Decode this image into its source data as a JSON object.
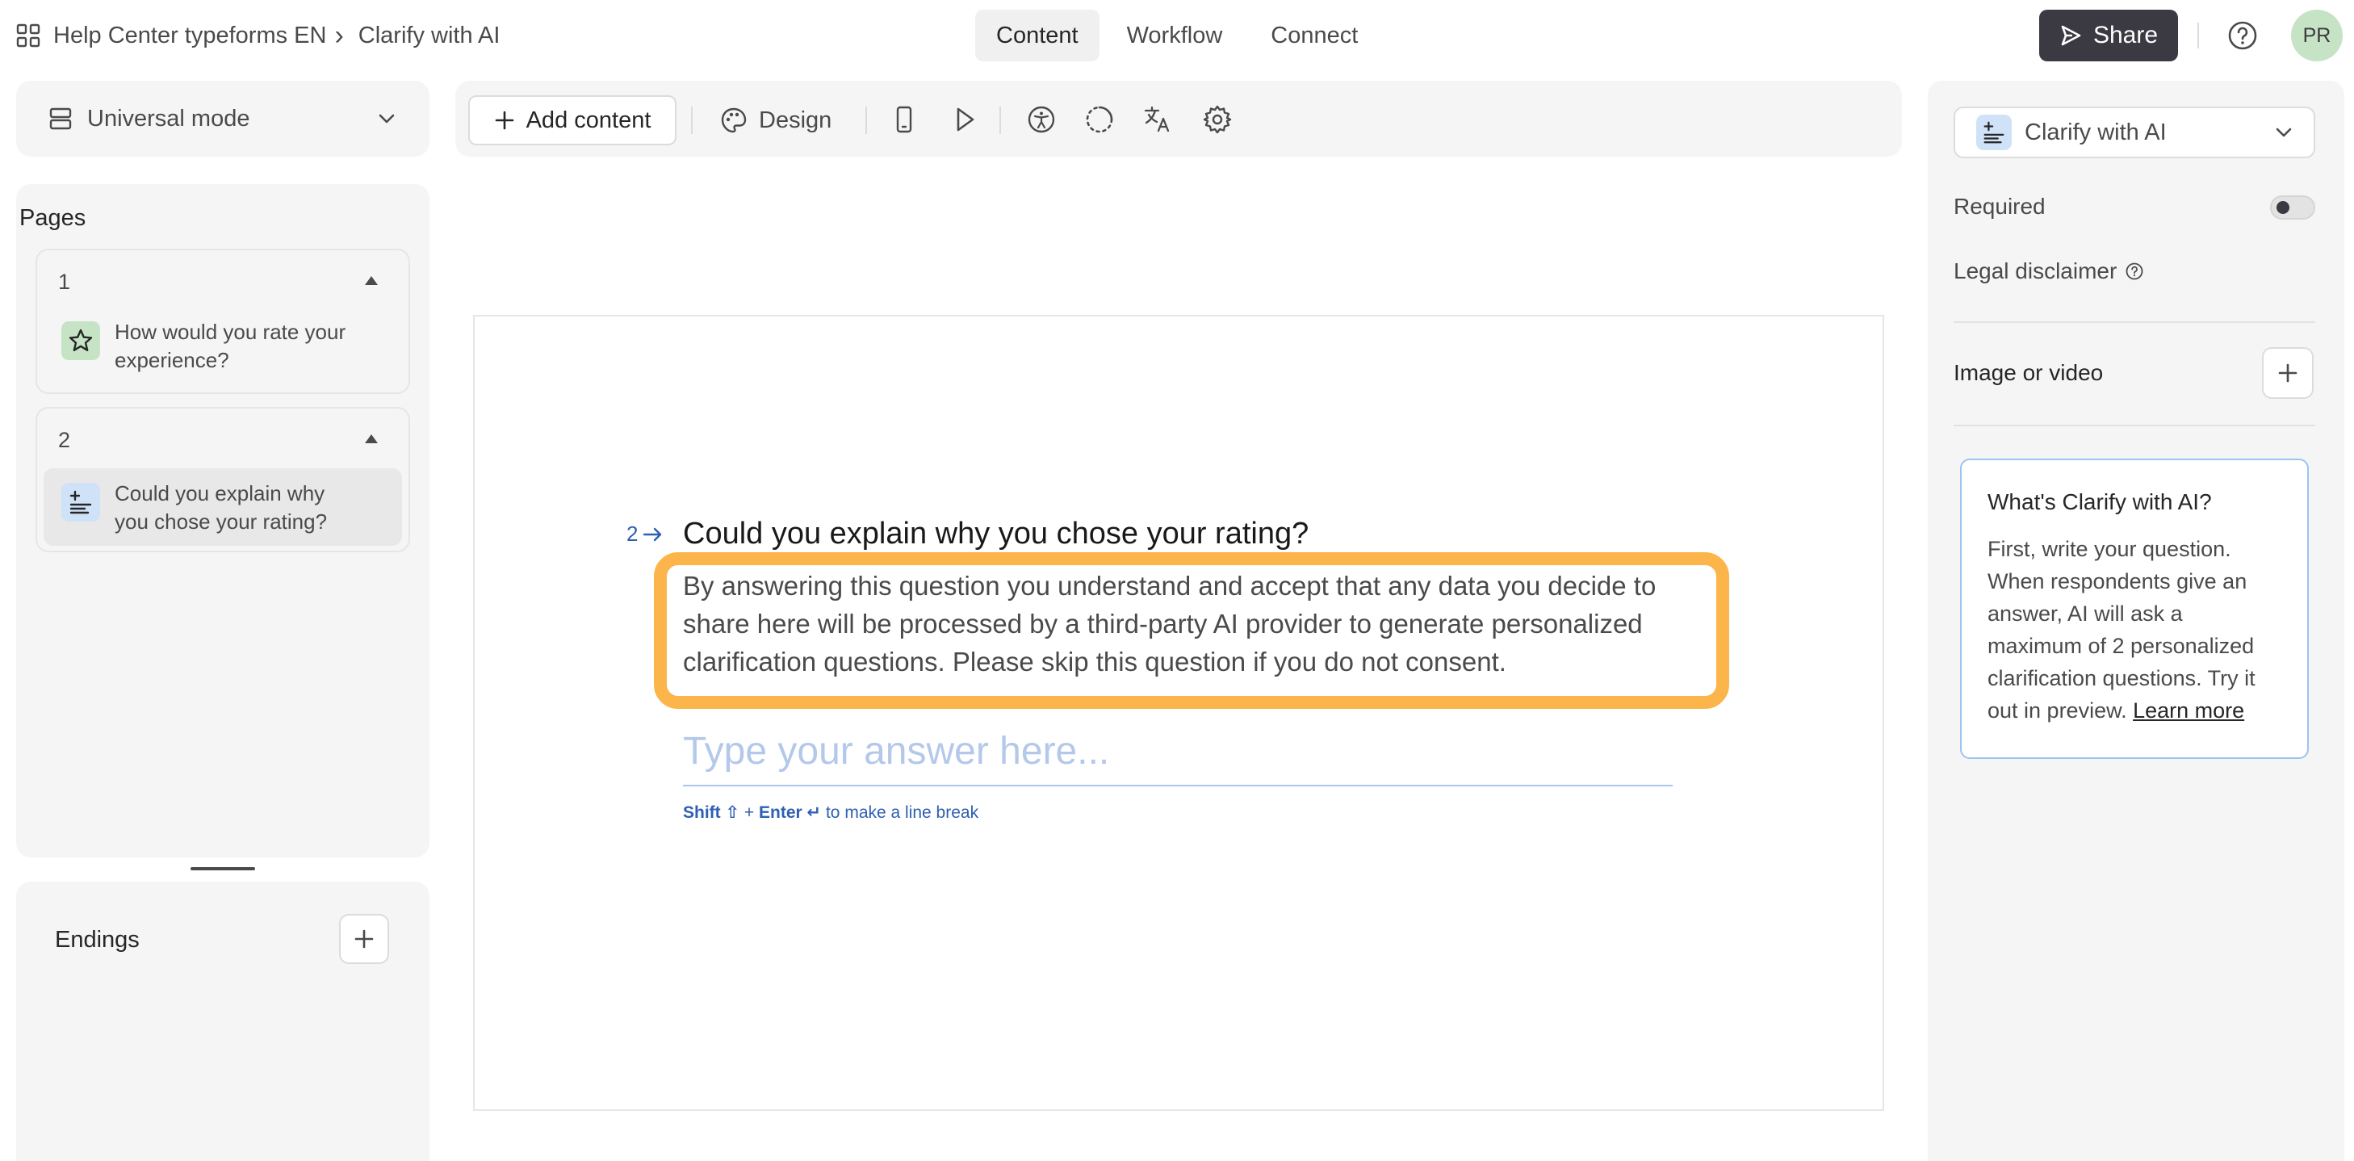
{
  "breadcrumb": {
    "workspace": "Help Center typeforms EN",
    "separator": "›",
    "form": "Clarify with AI"
  },
  "tabs": [
    {
      "label": "Content",
      "active": true
    },
    {
      "label": "Workflow",
      "active": false
    },
    {
      "label": "Connect",
      "active": false
    }
  ],
  "header": {
    "share_label": "Share",
    "avatar_initials": "PR"
  },
  "sidebar": {
    "mode_label": "Universal mode",
    "pages_title": "Pages",
    "pages": [
      {
        "number": "1",
        "question": "How would you rate your experience?",
        "icon": "star-icon"
      },
      {
        "number": "2",
        "question": "Could you explain why you chose your rating?",
        "icon": "clarify-ai-icon",
        "selected": true
      }
    ],
    "endings_title": "Endings"
  },
  "toolbar": {
    "add_content_label": "Add content",
    "design_label": "Design"
  },
  "canvas": {
    "question_number": "2",
    "question_title": "Could you explain why you chose your rating?",
    "disclaimer": "By answering this question you understand and accept that any data you decide to share here will be processed by a third-party AI provider to generate personalized clarification questions. Please skip this question if you do not consent.",
    "answer_placeholder": "Type your answer here...",
    "hint_shift": "Shift ⇧",
    "hint_plus": " + ",
    "hint_enter": "Enter ↵",
    "hint_rest": " to make a line break"
  },
  "settings": {
    "question_type": "Clarify with AI",
    "required_label": "Required",
    "required_on": false,
    "legal_label": "Legal disclaimer",
    "image_label": "Image or video",
    "info_title": "What's Clarify with AI?",
    "info_body": "First, write your question. When respondents give an answer, AI will ask a maximum of 2 personalized clarification questions. Try it out in preview. ",
    "info_link": "Learn more"
  },
  "colors": {
    "highlight": "#fbb54b",
    "share_bg": "#3b3942",
    "star_badge": "#c6e3c6",
    "ai_badge": "#cfe2f8",
    "accent_blue": "#2f5fb3"
  }
}
